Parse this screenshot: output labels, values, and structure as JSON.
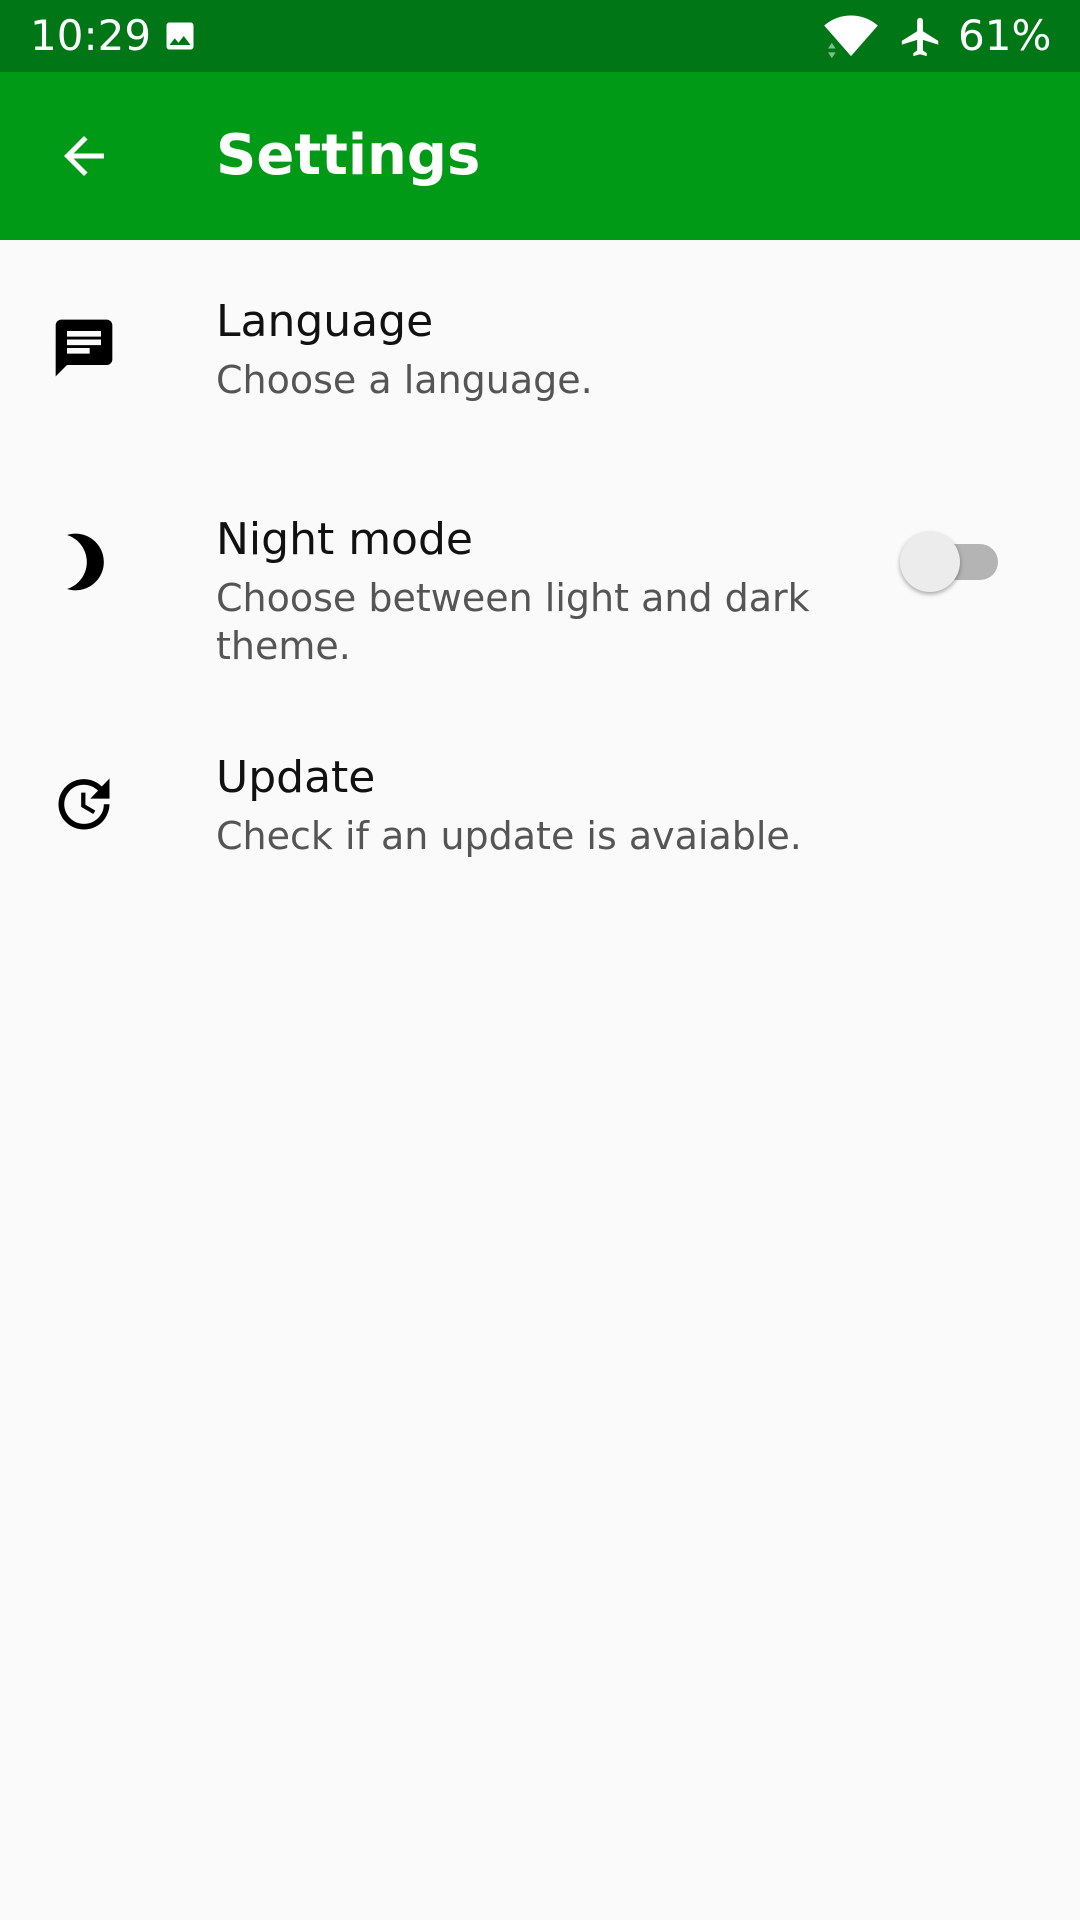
{
  "status_bar": {
    "time": "10:29",
    "battery": "61%",
    "icons": [
      "gallery-icon",
      "wifi-icon",
      "airplane-icon"
    ]
  },
  "app_bar": {
    "title": "Settings",
    "back_icon": "arrow-back-icon",
    "color": "#009a17",
    "status_color": "#007616"
  },
  "settings": {
    "items": [
      {
        "icon": "message-icon",
        "title": "Language",
        "summary": "Choose a language."
      },
      {
        "icon": "moon-icon",
        "title": "Night mode",
        "summary": "Choose between light and dark theme.",
        "toggle": false
      },
      {
        "icon": "update-icon",
        "title": "Update",
        "summary": "Check if an update is avaiable."
      }
    ]
  }
}
